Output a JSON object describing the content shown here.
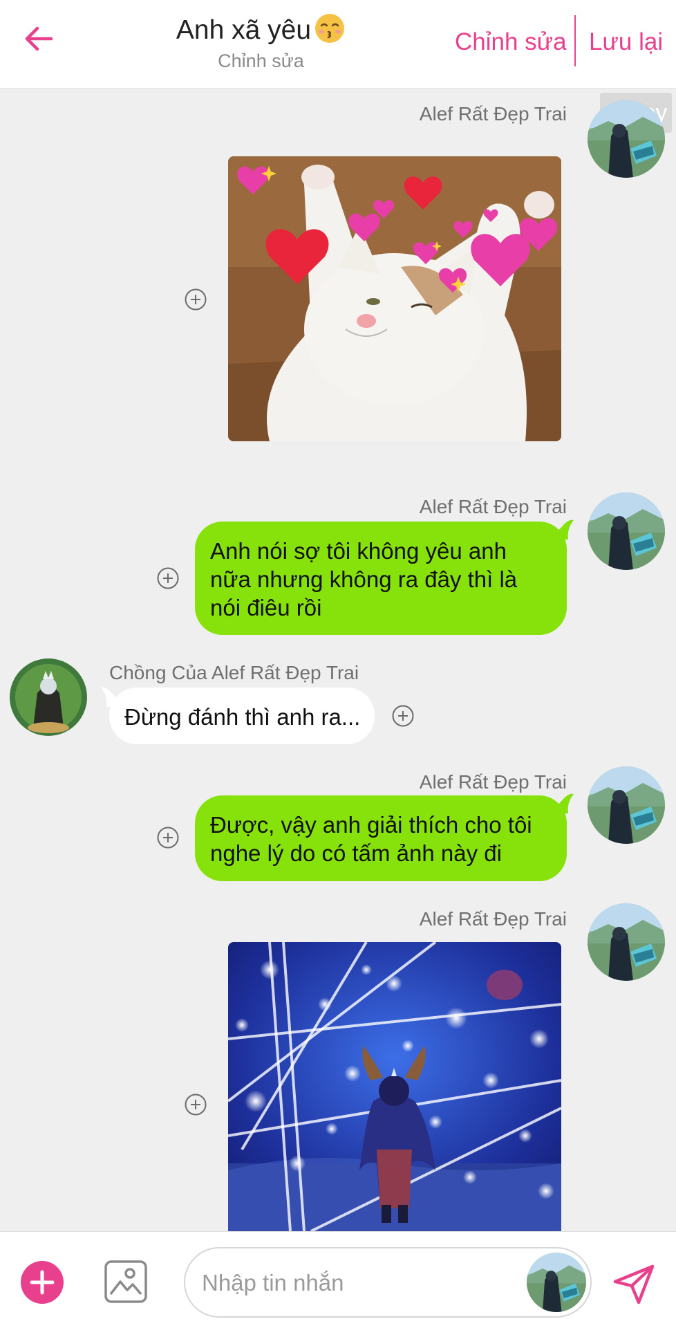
{
  "header": {
    "back_icon": "arrow-left-icon",
    "title": "Anh xã yêu",
    "title_emoji": "kissing-face-icon",
    "subtitle": "Chỉnh sửa",
    "edit_label": "Chỉnh sửa",
    "save_label": "Lưu lại",
    "accent_color": "#e8408d"
  },
  "watermark": "35 joy",
  "messages": [
    {
      "type": "image",
      "side": "right",
      "sender": "Alef Rất Đẹp Trai",
      "image": "cat-with-hearts"
    },
    {
      "type": "text",
      "side": "right",
      "sender": "Alef Rất Đẹp Trai",
      "lines": [
        "Anh nói sợ tôi không yêu anh",
        "nữa nhưng không ra đây thì là",
        "nói điêu rồi"
      ]
    },
    {
      "type": "text",
      "side": "left",
      "sender": "Chồng Của Alef Rất Đẹp Trai",
      "lines": [
        "Đừng đánh thì anh ra..."
      ]
    },
    {
      "type": "text",
      "side": "right",
      "sender": "Alef Rất Đẹp Trai",
      "lines": [
        "Được, vậy anh giải thích cho tôi",
        "nghe lý do có tấm ảnh này đi"
      ]
    },
    {
      "type": "image",
      "side": "right",
      "sender": "Alef Rất Đẹp Trai",
      "image": "game-character-night-lights"
    }
  ],
  "colors": {
    "bubble_right": "#86e20a",
    "bubble_left": "#ffffff",
    "background": "#efefef"
  },
  "composer": {
    "add_icon": "plus-icon",
    "gallery_icon": "image-icon",
    "placeholder": "Nhập tin nhắn",
    "send_icon": "send-icon"
  }
}
